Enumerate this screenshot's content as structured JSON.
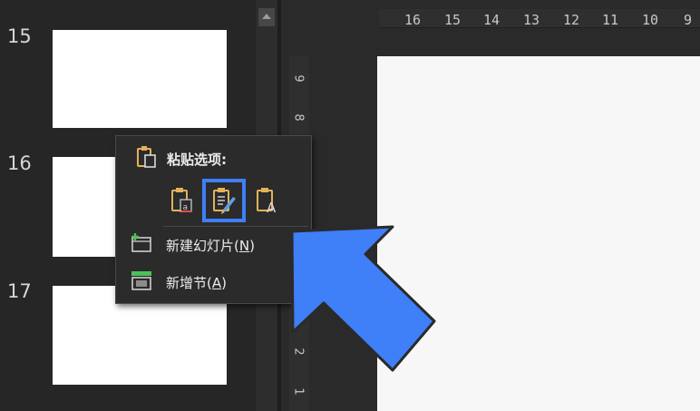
{
  "slides": [
    {
      "number": "15"
    },
    {
      "number": "16"
    },
    {
      "number": "17"
    }
  ],
  "ruler": {
    "horizontal_labels": [
      "16",
      "15",
      "14",
      "13",
      "12",
      "11",
      "10",
      "9"
    ],
    "vertical_labels": [
      "9",
      "8",
      "2",
      "1"
    ]
  },
  "context_menu": {
    "paste_options_label": "粘贴选项:",
    "paste_options": [
      {
        "icon": "paste-keep-source-formatting-icon"
      },
      {
        "icon": "paste-use-destination-theme-icon",
        "selected": true
      },
      {
        "icon": "paste-keep-text-only-icon"
      }
    ],
    "items": [
      {
        "label": "新建幻灯片(",
        "key": "N",
        "suffix": ")",
        "icon": "new-slide-icon"
      },
      {
        "label": "新增节(",
        "key": "A",
        "suffix": ")",
        "icon": "new-section-icon"
      }
    ]
  },
  "colors": {
    "highlight": "#3f7ff7",
    "arrow": "#3f7ff7",
    "background": "#262626"
  }
}
